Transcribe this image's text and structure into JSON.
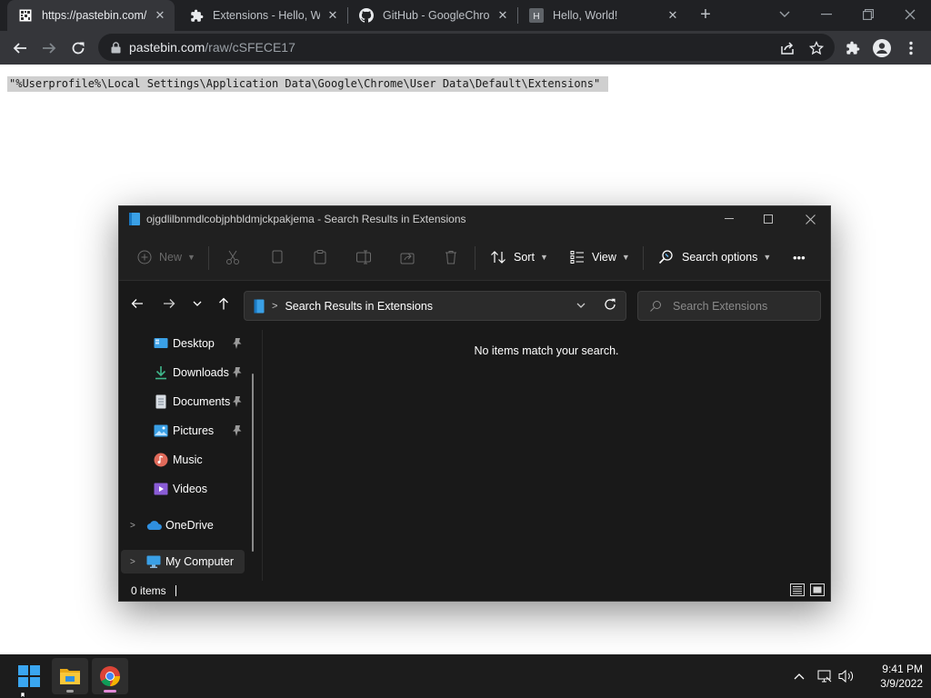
{
  "browser": {
    "tabs": [
      {
        "title": "https://pastebin.com/r",
        "favicon": "pastebin-icon",
        "active": true
      },
      {
        "title": "Extensions - Hello, Wor",
        "favicon": "puzzle-icon",
        "active": false
      },
      {
        "title": "GitHub - GoogleChrom",
        "favicon": "github-icon",
        "active": false
      },
      {
        "title": "Hello, World!",
        "favicon": "h-letter-icon",
        "active": false
      }
    ],
    "newtab_label": "+",
    "url_host": "pastebin.com",
    "url_path": "/raw/cSFECE17"
  },
  "page": {
    "raw_text": "\"%Userprofile%\\Local Settings\\Application Data\\Google\\Chrome\\User Data\\Default\\Extensions\" "
  },
  "explorer": {
    "title": "ojgdlilbnmdlcobjphbldmjckpakjema - Search Results in Extensions",
    "cmdbar": {
      "new": "New",
      "sort": "Sort",
      "view": "View",
      "search_options": "Search options",
      "more": "•••"
    },
    "address": "Search Results in Extensions",
    "search_placeholder": "Search Extensions",
    "nav": {
      "desktop": "Desktop",
      "downloads": "Downloads",
      "documents": "Documents",
      "pictures": "Pictures",
      "music": "Music",
      "videos": "Videos",
      "onedrive": "OneDrive",
      "my_computer": "My Computer"
    },
    "empty_message": "No items match your search.",
    "status_count": "0 items"
  },
  "taskbar": {
    "time": "9:41 PM",
    "date": "3/9/2022"
  },
  "colors": {
    "chrome_dark": "#202124",
    "chrome_toolbar": "#35363a",
    "explorer_bg": "#191919",
    "taskbar_bg": "#1c1c1c",
    "windows_blue": "#1e90e8"
  }
}
